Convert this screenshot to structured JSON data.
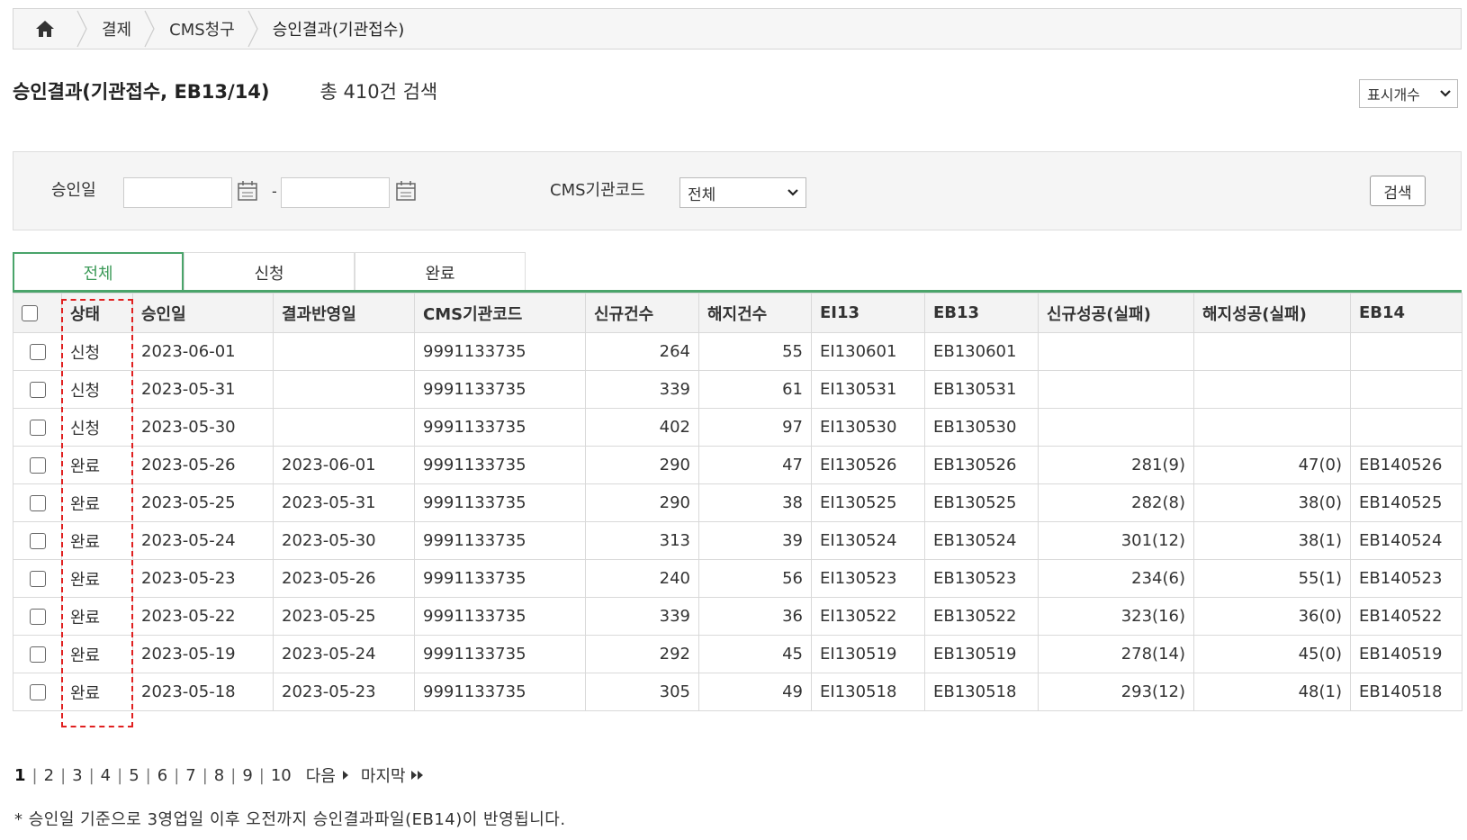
{
  "breadcrumb": {
    "home_icon": "home-icon",
    "items": [
      "결제",
      "CMS청구",
      "승인결과(기관접수)"
    ]
  },
  "header": {
    "title": "승인결과(기관접수, EB13/14)",
    "total": "총 410건 검색",
    "display_select": "표시개수"
  },
  "filters": {
    "date_label": "승인일",
    "date_from": "",
    "date_to": "",
    "date_separator": "-",
    "cms_label": "CMS기관코드",
    "cms_value": "전체",
    "search_button": "검색"
  },
  "tabs": [
    "전체",
    "신청",
    "완료"
  ],
  "table": {
    "headers": [
      "상태",
      "승인일",
      "결과반영일",
      "CMS기관코드",
      "신규건수",
      "해지건수",
      "EI13",
      "EB13",
      "신규성공(실패)",
      "해지성공(실패)",
      "EB14"
    ],
    "rows": [
      [
        "신청",
        "2023-06-01",
        "",
        "9991133735",
        "264",
        "55",
        "EI130601",
        "EB130601",
        "",
        "",
        ""
      ],
      [
        "신청",
        "2023-05-31",
        "",
        "9991133735",
        "339",
        "61",
        "EI130531",
        "EB130531",
        "",
        "",
        ""
      ],
      [
        "신청",
        "2023-05-30",
        "",
        "9991133735",
        "402",
        "97",
        "EI130530",
        "EB130530",
        "",
        "",
        ""
      ],
      [
        "완료",
        "2023-05-26",
        "2023-06-01",
        "9991133735",
        "290",
        "47",
        "EI130526",
        "EB130526",
        "281(9)",
        "47(0)",
        "EB140526"
      ],
      [
        "완료",
        "2023-05-25",
        "2023-05-31",
        "9991133735",
        "290",
        "38",
        "EI130525",
        "EB130525",
        "282(8)",
        "38(0)",
        "EB140525"
      ],
      [
        "완료",
        "2023-05-24",
        "2023-05-30",
        "9991133735",
        "313",
        "39",
        "EI130524",
        "EB130524",
        "301(12)",
        "38(1)",
        "EB140524"
      ],
      [
        "완료",
        "2023-05-23",
        "2023-05-26",
        "9991133735",
        "240",
        "56",
        "EI130523",
        "EB130523",
        "234(6)",
        "55(1)",
        "EB140523"
      ],
      [
        "완료",
        "2023-05-22",
        "2023-05-25",
        "9991133735",
        "339",
        "36",
        "EI130522",
        "EB130522",
        "323(16)",
        "36(0)",
        "EB140522"
      ],
      [
        "완료",
        "2023-05-19",
        "2023-05-24",
        "9991133735",
        "292",
        "45",
        "EI130519",
        "EB130519",
        "278(14)",
        "45(0)",
        "EB140519"
      ],
      [
        "완료",
        "2023-05-18",
        "2023-05-23",
        "9991133735",
        "305",
        "49",
        "EI130518",
        "EB130518",
        "293(12)",
        "48(1)",
        "EB140518"
      ]
    ]
  },
  "pagination": {
    "pages": [
      "1",
      "2",
      "3",
      "4",
      "5",
      "6",
      "7",
      "8",
      "9",
      "10"
    ],
    "current": "1",
    "next": "다음",
    "last": "마지막"
  },
  "note": "* 승인일 기준으로 3영업일 이후 오전까지 승인결과파일(EB14)이 반영됩니다.",
  "colors": {
    "accent": "#4aa46a",
    "highlight": "#e02020"
  }
}
